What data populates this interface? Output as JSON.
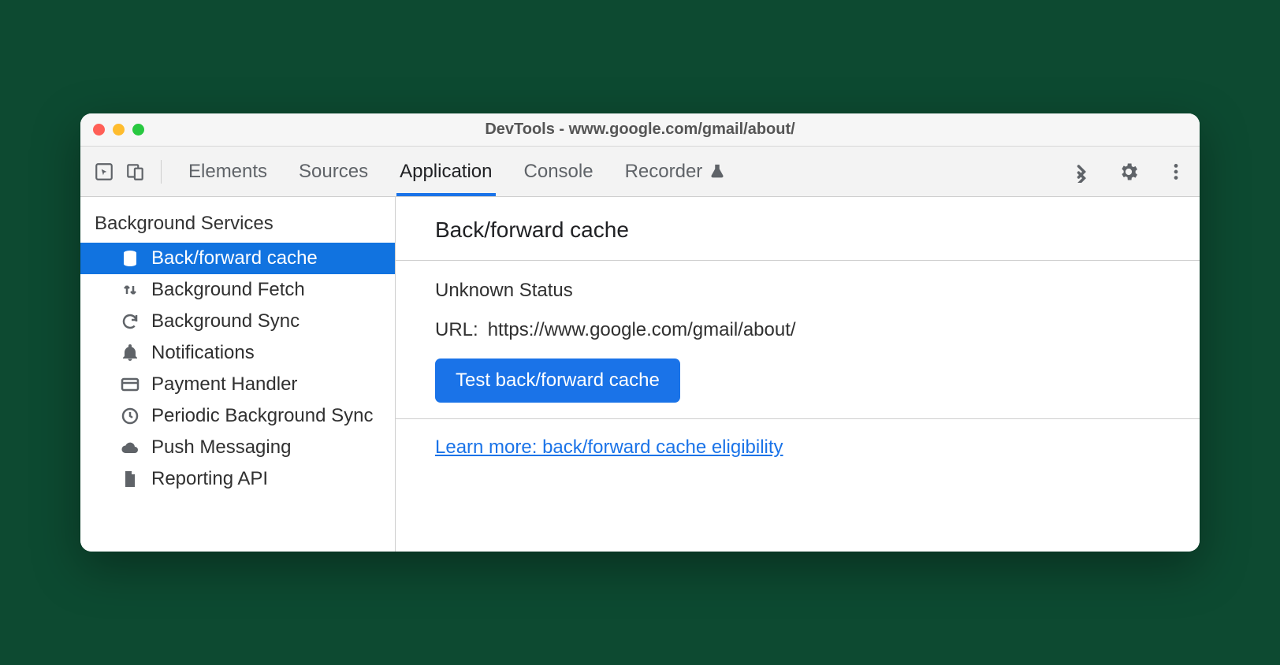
{
  "window": {
    "title": "DevTools - www.google.com/gmail/about/"
  },
  "tabs": {
    "items": [
      "Elements",
      "Sources",
      "Application",
      "Console",
      "Recorder"
    ],
    "active_index": 2
  },
  "sidebar": {
    "heading": "Background Services",
    "items": [
      {
        "label": "Back/forward cache",
        "icon": "database-icon",
        "selected": true
      },
      {
        "label": "Background Fetch",
        "icon": "updown-icon",
        "selected": false
      },
      {
        "label": "Background Sync",
        "icon": "sync-icon",
        "selected": false
      },
      {
        "label": "Notifications",
        "icon": "bell-icon",
        "selected": false
      },
      {
        "label": "Payment Handler",
        "icon": "card-icon",
        "selected": false
      },
      {
        "label": "Periodic Background Sync",
        "icon": "clock-icon",
        "selected": false
      },
      {
        "label": "Push Messaging",
        "icon": "cloud-icon",
        "selected": false
      },
      {
        "label": "Reporting API",
        "icon": "file-icon",
        "selected": false
      }
    ]
  },
  "main": {
    "heading": "Back/forward cache",
    "status": "Unknown Status",
    "url_label": "URL:",
    "url_value": "https://www.google.com/gmail/about/",
    "button_label": "Test back/forward cache",
    "link_text": "Learn more: back/forward cache eligibility"
  }
}
